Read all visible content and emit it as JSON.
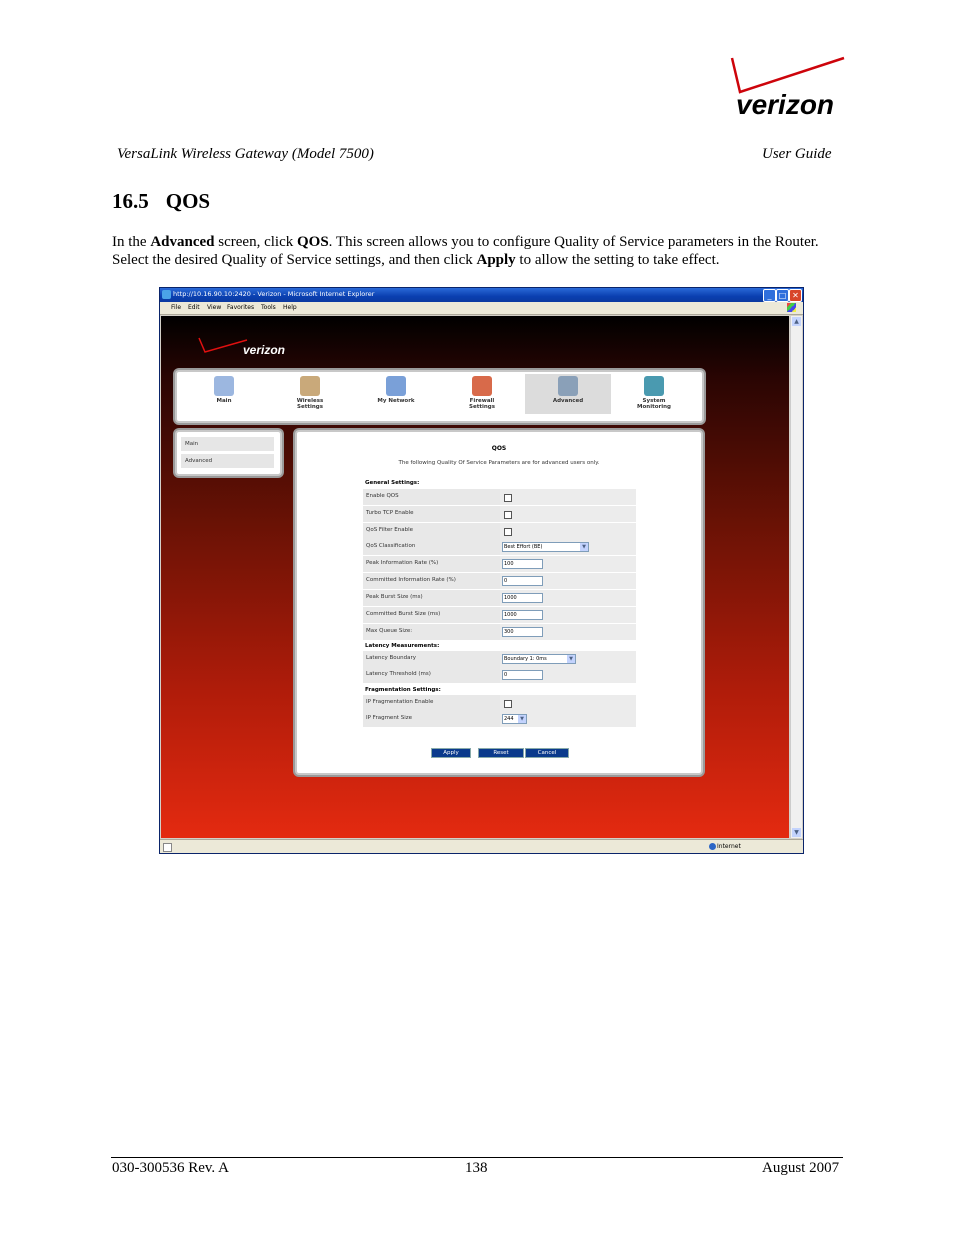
{
  "page_header": {
    "logo_text": "verizon",
    "doc_title": "VersaLink Wireless Gateway (Model 7500)",
    "doc_type": "User Guide"
  },
  "section": {
    "number": "16.5",
    "title": "QOS"
  },
  "intro": {
    "p1": "In the ",
    "b1": "Advanced",
    "p2": " screen, click ",
    "b2": "QOS",
    "p3": ".  This screen allows you to configure Quality of Service parameters in the Router. Select the desired Quality of Service settings, and then click ",
    "b3": "Apply",
    "p4": " to allow the setting to take effect."
  },
  "browser": {
    "title": "http://10.16.90.10:2420 - Verizon - Microsoft Internet Explorer",
    "menu": [
      "File",
      "Edit",
      "View",
      "Favorites",
      "Tools",
      "Help"
    ],
    "status_zone": "Internet",
    "window_buttons": [
      "_",
      "□",
      "✕"
    ]
  },
  "app": {
    "logo_text": "verizon",
    "nav": [
      {
        "label": "Main"
      },
      {
        "label": "Wireless Settings"
      },
      {
        "label": "My Network"
      },
      {
        "label": "Firewall Settings"
      },
      {
        "label": "Advanced"
      },
      {
        "label": "System Monitoring"
      }
    ],
    "left_menu": [
      "Main",
      "Advanced"
    ],
    "panel_title": "QOS",
    "panel_subtitle": "The following Quality Of Service Parameters are for advanced users only.",
    "general_heading": "General Settings:",
    "general_rows": [
      {
        "label": "Enable QOS",
        "type": "checkbox"
      },
      {
        "label": "Turbo TCP Enable",
        "type": "checkbox"
      },
      {
        "label": "QoS Filter Enable",
        "type": "checkbox"
      },
      {
        "label": "QoS Classification",
        "type": "select",
        "value": "Best Effort (BE)"
      },
      {
        "label": "Peak Information Rate (%)",
        "type": "text",
        "value": "100"
      },
      {
        "label": "Committed Information Rate (%)",
        "type": "text",
        "value": "0"
      },
      {
        "label": "Peak Burst Size (ms)",
        "type": "text",
        "value": "1000"
      },
      {
        "label": "Committed Burst Size (ms)",
        "type": "text",
        "value": "1000"
      },
      {
        "label": "Max Queue Size:",
        "type": "text",
        "value": "300"
      }
    ],
    "latency_heading": "Latency Measurements:",
    "latency_rows": [
      {
        "label": "Latency Boundary",
        "type": "select",
        "value": "Boundary 1: 0ms"
      },
      {
        "label": "Latency Threshold (ms)",
        "type": "text",
        "value": "0"
      }
    ],
    "frag_heading": "Fragmentation Settings:",
    "frag_rows": [
      {
        "label": "IP Fragmentation Enable",
        "type": "checkbox"
      },
      {
        "label": "IP Fragment Size",
        "type": "select",
        "value": "244"
      }
    ],
    "buttons": {
      "apply": "Apply",
      "reset": "Reset",
      "cancel": "Cancel"
    }
  },
  "footer": {
    "doc_number": "030-300536 Rev. A",
    "page": "138",
    "date": "August 2007"
  }
}
